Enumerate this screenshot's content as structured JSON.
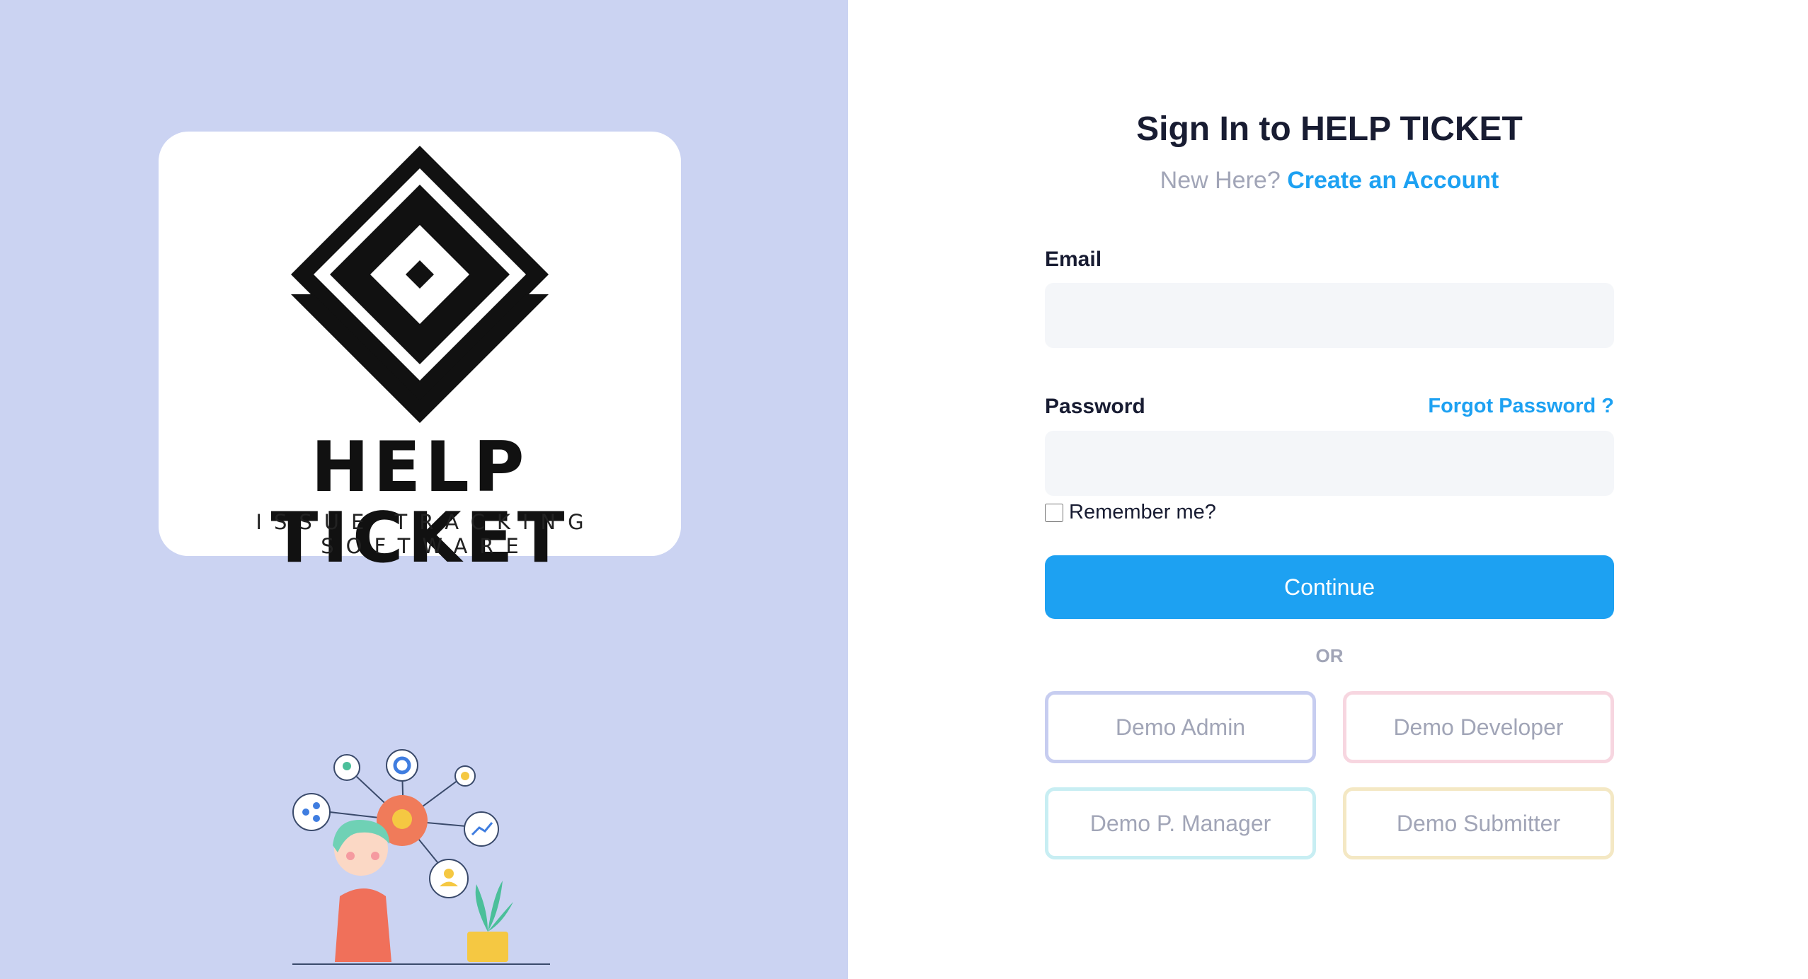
{
  "brand": {
    "name": "HELP TICKET",
    "tagline": "ISSUE TRACKING SOFTWARE"
  },
  "signin": {
    "title": "Sign In to HELP TICKET",
    "new_here": "New Here?",
    "create_account": "Create an Account"
  },
  "form": {
    "email_label": "Email",
    "email_value": "",
    "password_label": "Password",
    "password_value": "",
    "forgot_password": "Forgot Password ?",
    "remember_label": "Remember me?",
    "remember_checked": false,
    "continue_label": "Continue",
    "or_label": "OR"
  },
  "demo_buttons": {
    "admin": "Demo Admin",
    "developer": "Demo Developer",
    "manager": "Demo P. Manager",
    "submitter": "Demo Submitter"
  },
  "colors": {
    "left_panel": "#cbd3f2",
    "accent": "#1da1f2",
    "heading": "#181c32",
    "muted": "#a1a5b7"
  }
}
